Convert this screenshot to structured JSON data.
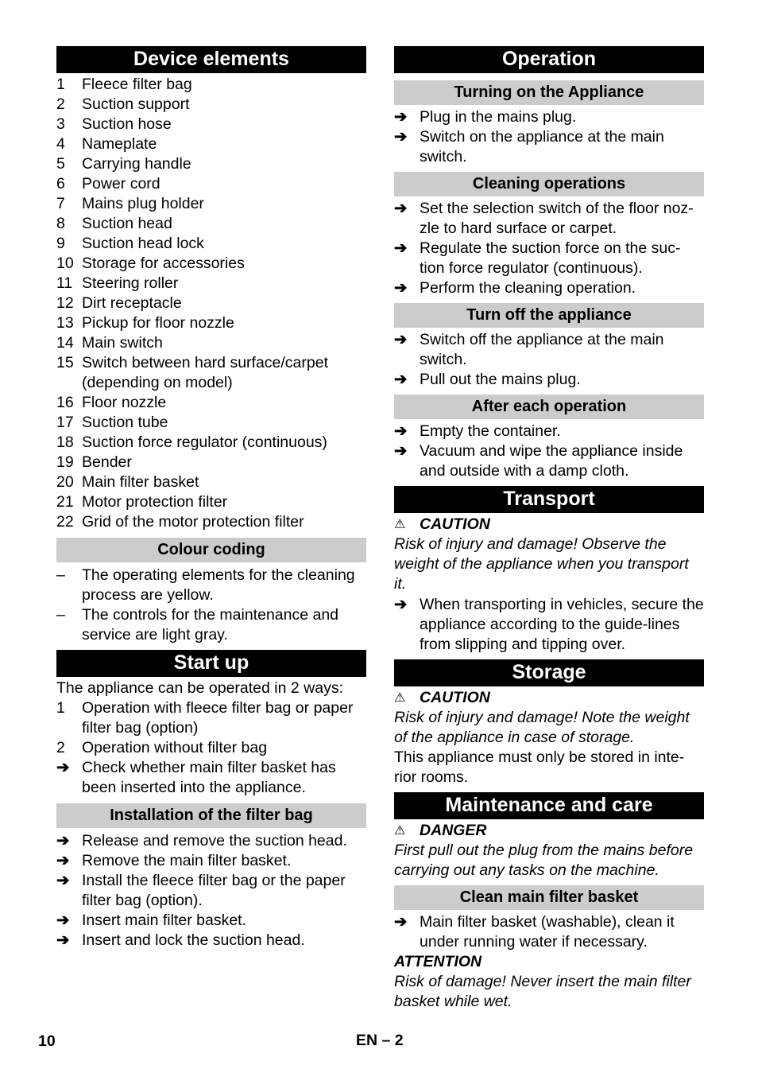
{
  "left": {
    "device_elements": {
      "title": "Device elements",
      "items": [
        {
          "num": "1",
          "text": "Fleece filter bag"
        },
        {
          "num": "2",
          "text": "Suction support"
        },
        {
          "num": "3",
          "text": "Suction hose"
        },
        {
          "num": "4",
          "text": "Nameplate"
        },
        {
          "num": "5",
          "text": "Carrying handle"
        },
        {
          "num": "6",
          "text": "Power cord"
        },
        {
          "num": "7",
          "text": "Mains plug holder"
        },
        {
          "num": "8",
          "text": "Suction head"
        },
        {
          "num": "9",
          "text": "Suction head lock"
        },
        {
          "num": "10",
          "text": "Storage for accessories"
        },
        {
          "num": "11",
          "text": "Steering roller"
        },
        {
          "num": "12",
          "text": "Dirt receptacle"
        },
        {
          "num": "13",
          "text": "Pickup for floor nozzle"
        },
        {
          "num": "14",
          "text": "Main switch"
        },
        {
          "num": "15",
          "text": "Switch between hard surface/carpet (depending on model)"
        },
        {
          "num": "16",
          "text": "Floor nozzle"
        },
        {
          "num": "17",
          "text": "Suction tube"
        },
        {
          "num": "18",
          "text": "Suction force regulator (continuous)"
        },
        {
          "num": "19",
          "text": "Bender"
        },
        {
          "num": "20",
          "text": "Main filter basket"
        },
        {
          "num": "21",
          "text": "Motor protection filter"
        },
        {
          "num": "22",
          "text": "Grid of the motor protection filter"
        }
      ]
    },
    "colour_coding": {
      "title": "Colour coding",
      "items": [
        {
          "mark": "–",
          "text": "The operating elements for the cleaning process are yellow."
        },
        {
          "mark": "–",
          "text": "The controls for the maintenance and service are light gray."
        }
      ]
    },
    "start_up": {
      "title": "Start up",
      "intro": "The appliance can be operated in 2 ways:",
      "items": [
        {
          "mark": "1",
          "text": "Operation with fleece filter bag or paper filter bag (option)"
        },
        {
          "mark": "2",
          "text": "Operation without filter bag"
        },
        {
          "mark": "➔",
          "text": "Check whether main filter basket has been inserted into the appliance."
        }
      ]
    },
    "installation": {
      "title": "Installation of the filter bag",
      "items": [
        {
          "mark": "➔",
          "text": "Release and remove the suction head."
        },
        {
          "mark": "➔",
          "text": "Remove the main filter basket."
        },
        {
          "mark": "➔",
          "text": "Install the fleece filter bag or the paper filter bag (option)."
        },
        {
          "mark": "➔",
          "text": "Insert main filter basket."
        },
        {
          "mark": "➔",
          "text": "Insert and lock the suction head."
        }
      ]
    }
  },
  "right": {
    "operation": {
      "title": "Operation",
      "turning_on": {
        "title": "Turning on the Appliance",
        "items": [
          {
            "mark": "➔",
            "text": "Plug in the mains plug."
          },
          {
            "mark": "➔",
            "text": "Switch on the appliance at the main switch."
          }
        ]
      },
      "cleaning": {
        "title": "Cleaning operations",
        "items": [
          {
            "mark": "➔",
            "text": "Set the selection switch of the floor noz-zle to hard surface or carpet."
          },
          {
            "mark": "➔",
            "text": "Regulate the suction force on the suc-tion force regulator (continuous)."
          },
          {
            "mark": "➔",
            "text": "Perform the cleaning operation."
          }
        ]
      },
      "turn_off": {
        "title": "Turn off the appliance",
        "items": [
          {
            "mark": "➔",
            "text": "Switch off the appliance at the main switch."
          },
          {
            "mark": "➔",
            "text": "Pull out the mains plug."
          }
        ]
      },
      "after_each": {
        "title": "After each operation",
        "items": [
          {
            "mark": "➔",
            "text": "Empty the container."
          },
          {
            "mark": "➔",
            "text": "Vacuum and wipe the appliance inside and outside with a damp cloth."
          }
        ]
      }
    },
    "transport": {
      "title": "Transport",
      "warning_symbol": "⚠",
      "warning_label": "CAUTION",
      "warning_text": "Risk of injury and damage! Observe the weight of the appliance when you transport it.",
      "items": [
        {
          "mark": "➔",
          "text": "When transporting in vehicles, secure the appliance according to the guide-lines from slipping and tipping over."
        }
      ]
    },
    "storage": {
      "title": "Storage",
      "warning_symbol": "⚠",
      "warning_label": "CAUTION",
      "warning_text": "Risk of injury and damage! Note the weight of the appliance in case of storage.",
      "body": "This appliance must only be stored in inte-rior rooms."
    },
    "maintenance": {
      "title": "Maintenance and care",
      "warning_symbol": "⚠",
      "warning_label": "DANGER",
      "warning_text": "First pull out the plug from the mains before carrying out any tasks on the machine.",
      "clean_basket": {
        "title": "Clean main filter basket",
        "items": [
          {
            "mark": "➔",
            "text": "Main filter basket (washable), clean it under running water if necessary."
          }
        ],
        "attention_label": "ATTENTION",
        "attention_text": "Risk of damage! Never insert the main filter basket while wet."
      }
    }
  },
  "footer": {
    "page_number": "10",
    "section": "EN – 2"
  }
}
